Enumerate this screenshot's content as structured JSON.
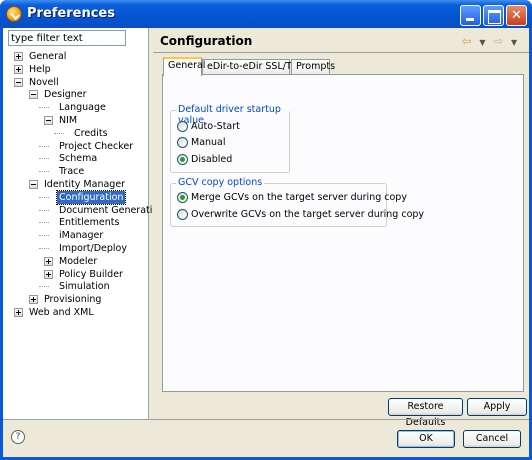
{
  "window": {
    "title": "Preferences"
  },
  "filter": {
    "placeholder": "type filter text",
    "value": "type filter text"
  },
  "tree": [
    {
      "label": "General",
      "depth": 0,
      "expander": "plus"
    },
    {
      "label": "Help",
      "depth": 0,
      "expander": "plus"
    },
    {
      "label": "Novell",
      "depth": 0,
      "expander": "minus"
    },
    {
      "label": "Designer",
      "depth": 1,
      "expander": "minus"
    },
    {
      "label": "Language",
      "depth": 2,
      "expander": "none"
    },
    {
      "label": "NIM",
      "depth": 2,
      "expander": "minus"
    },
    {
      "label": "Credits",
      "depth": 3,
      "expander": "none"
    },
    {
      "label": "Project Checker",
      "depth": 2,
      "expander": "none"
    },
    {
      "label": "Schema",
      "depth": 2,
      "expander": "none"
    },
    {
      "label": "Trace",
      "depth": 2,
      "expander": "none"
    },
    {
      "label": "Identity Manager",
      "depth": 1,
      "expander": "minus"
    },
    {
      "label": "Configuration",
      "depth": 2,
      "expander": "none",
      "selected": true
    },
    {
      "label": "Document Generation",
      "depth": 2,
      "expander": "none"
    },
    {
      "label": "Entitlements",
      "depth": 2,
      "expander": "none"
    },
    {
      "label": "iManager",
      "depth": 2,
      "expander": "none"
    },
    {
      "label": "Import/Deploy",
      "depth": 2,
      "expander": "none"
    },
    {
      "label": "Modeler",
      "depth": 2,
      "expander": "plus"
    },
    {
      "label": "Policy Builder",
      "depth": 2,
      "expander": "plus"
    },
    {
      "label": "Simulation",
      "depth": 2,
      "expander": "none"
    },
    {
      "label": "Provisioning",
      "depth": 1,
      "expander": "plus"
    },
    {
      "label": "Web and XML",
      "depth": 0,
      "expander": "plus"
    }
  ],
  "page": {
    "title": "Configuration",
    "tabs": [
      "General",
      "eDir-to-eDir SSL/TLS",
      "Prompts"
    ],
    "active_tab": 0
  },
  "startup_group": {
    "title": "Default driver startup value",
    "options": [
      {
        "label": "Auto-Start",
        "checked": false
      },
      {
        "label": "Manual",
        "checked": false
      },
      {
        "label": "Disabled",
        "checked": true
      }
    ]
  },
  "gcv_group": {
    "title": "GCV copy options",
    "options": [
      {
        "label": "Merge GCVs on the target server during copy",
        "checked": true
      },
      {
        "label": "Overwrite GCVs on the target server during copy",
        "checked": false
      }
    ]
  },
  "buttons": {
    "restore_defaults": "Restore Defaults",
    "apply": "Apply",
    "ok": "OK",
    "cancel": "Cancel"
  },
  "icons": {
    "help": "?",
    "back": "⇦",
    "dropdown": "▼",
    "forward": "⇨",
    "close": "✕"
  }
}
